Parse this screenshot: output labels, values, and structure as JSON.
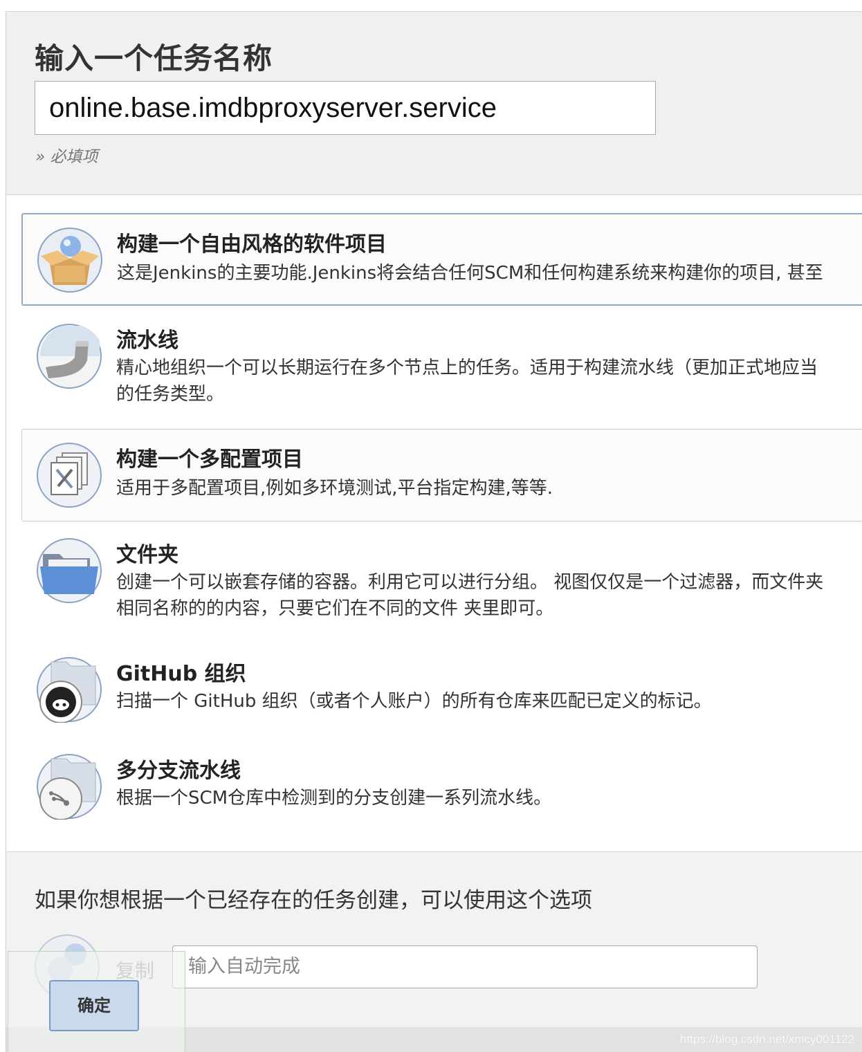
{
  "header": {
    "title": "输入一个任务名称",
    "name_value": "online.base.imdbproxyserver.service",
    "required_note": "» 必填项"
  },
  "item_types": [
    {
      "title": "构建一个自由风格的软件项目",
      "desc_lines": [
        "这是Jenkins的主要功能.Jenkins将会结合任何SCM和任何构建系统来构建你的项目, 甚至"
      ],
      "icon": "freestyle-box-icon",
      "selected": true
    },
    {
      "title": "流水线",
      "desc_lines": [
        "精心地组织一个可以长期运行在多个节点上的任务。适用于构建流水线（更加正式地应当",
        "的任务类型。"
      ],
      "icon": "pipeline-icon",
      "selected": false
    },
    {
      "title": "构建一个多配置项目",
      "desc_lines": [
        "适用于多配置项目,例如多环境测试,平台指定构建,等等."
      ],
      "icon": "multi-config-icon",
      "selected": false
    },
    {
      "title": "文件夹",
      "desc_lines": [
        "创建一个可以嵌套存储的容器。利用它可以进行分组。 视图仅仅是一个过滤器，而文件夹",
        "相同名称的的内容，只要它们在不同的文件 夹里即可。"
      ],
      "icon": "folder-icon",
      "selected": false
    },
    {
      "title": "GitHub 组织",
      "desc_lines": [
        "扫描一个 GitHub 组织（或者个人账户）的所有仓库来匹配已定义的标记。"
      ],
      "icon": "github-organization-icon",
      "selected": false
    },
    {
      "title": "多分支流水线",
      "desc_lines": [
        "根据一个SCM仓库中检测到的分支创建一系列流水线。"
      ],
      "icon": "multibranch-pipeline-icon",
      "selected": false
    }
  ],
  "copy": {
    "heading": "如果你想根据一个已经存在的任务创建，可以使用这个选项",
    "label": "复制",
    "placeholder": "输入自动完成"
  },
  "ok_button": "确定",
  "watermark": "https://blog.csdn.net/xmcy001122",
  "colors": {
    "selected_border": "#8ea8c6",
    "ok_button_bg": "#c9d9ee",
    "header_bg": "#f0f0f0"
  }
}
